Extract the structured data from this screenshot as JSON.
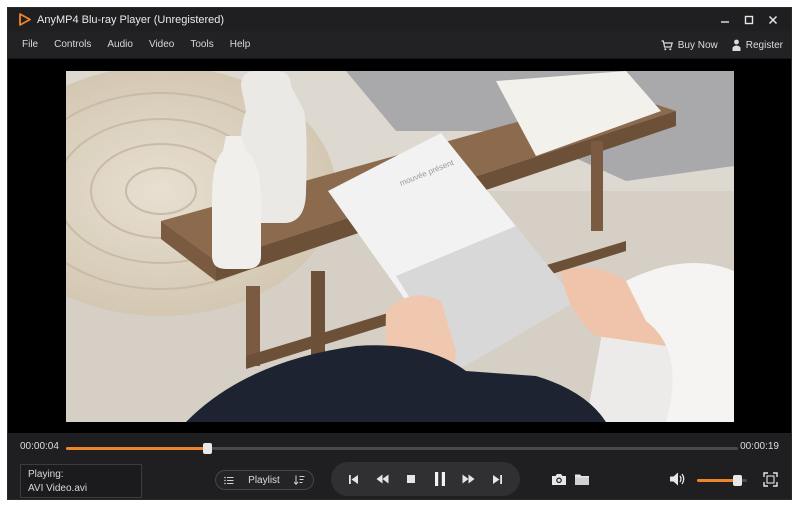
{
  "window": {
    "title": "AnyMP4 Blu-ray Player (Unregistered)",
    "accent_color": "#f0842b"
  },
  "menu": {
    "items": [
      {
        "label": "File"
      },
      {
        "label": "Controls"
      },
      {
        "label": "Audio"
      },
      {
        "label": "Video"
      },
      {
        "label": "Tools"
      },
      {
        "label": "Help"
      }
    ],
    "buy_now": "Buy Now",
    "register": "Register"
  },
  "video": {
    "book_title": "mouvée présent"
  },
  "playback": {
    "current_time": "00:00:04",
    "duration": "00:00:19",
    "progress_fraction": 0.21,
    "playing_label": "Playing:",
    "file_name": "AVI Video.avi",
    "playlist_label": "Playlist",
    "volume_fraction": 0.8
  },
  "icons": [
    "play-logo-icon",
    "minimize-icon",
    "maximize-icon",
    "close-icon",
    "cart-icon",
    "user-icon",
    "list-icon",
    "sort-icon",
    "skip-previous-icon",
    "rewind-icon",
    "stop-icon",
    "pause-icon",
    "fast-forward-icon",
    "skip-next-icon",
    "camera-icon",
    "folder-icon",
    "volume-icon",
    "fullscreen-icon"
  ]
}
